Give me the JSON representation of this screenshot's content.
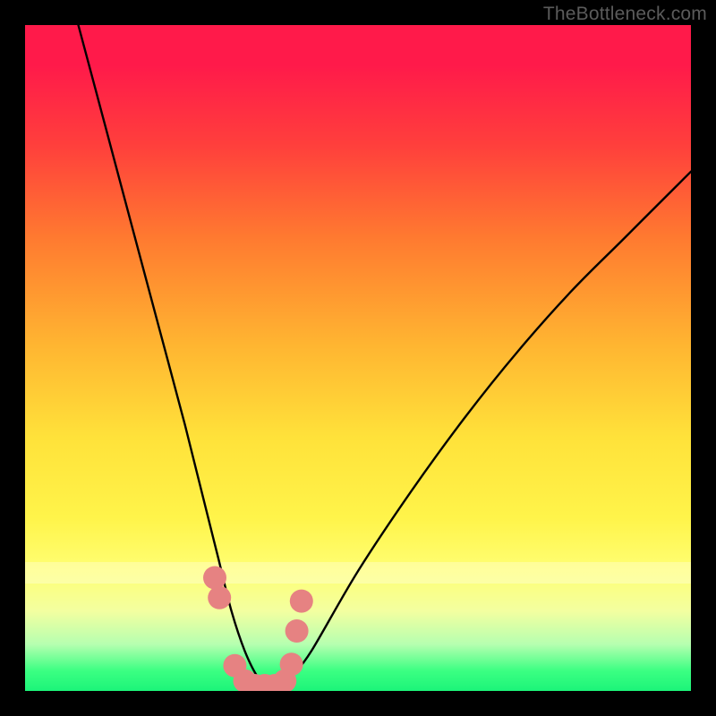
{
  "watermark": "TheBottleneck.com",
  "chart_data": {
    "type": "line",
    "title": "",
    "xlabel": "",
    "ylabel": "",
    "xlim": [
      0,
      100
    ],
    "ylim": [
      0,
      100
    ],
    "series": [
      {
        "name": "bottleneck-curve",
        "x": [
          8,
          12,
          16,
          20,
          24,
          27,
          29,
          31,
          33,
          35,
          37,
          39,
          40,
          43,
          50,
          58,
          66,
          74,
          82,
          90,
          98,
          100
        ],
        "values": [
          100,
          85,
          70,
          55,
          40,
          28,
          20,
          12,
          6,
          2,
          0,
          0,
          2,
          6,
          18,
          30,
          41,
          51,
          60,
          68,
          76,
          78
        ]
      }
    ],
    "markers": {
      "name": "highlight-points",
      "color": "#e68282",
      "x": [
        28.5,
        29.2,
        31.5,
        33.0,
        34.5,
        36.0,
        37.5,
        39.0,
        40.0,
        40.8,
        41.5
      ],
      "values": [
        17.0,
        14.0,
        3.8,
        1.5,
        0.8,
        0.8,
        0.8,
        1.5,
        4.0,
        9.0,
        13.5
      ]
    },
    "gradient_stops": [
      {
        "pos": 0.0,
        "color": "#ff1a4a",
        "meaning": "severe"
      },
      {
        "pos": 0.5,
        "color": "#ffd83a",
        "meaning": "moderate"
      },
      {
        "pos": 0.97,
        "color": "#3bff82",
        "meaning": "optimal"
      }
    ]
  }
}
